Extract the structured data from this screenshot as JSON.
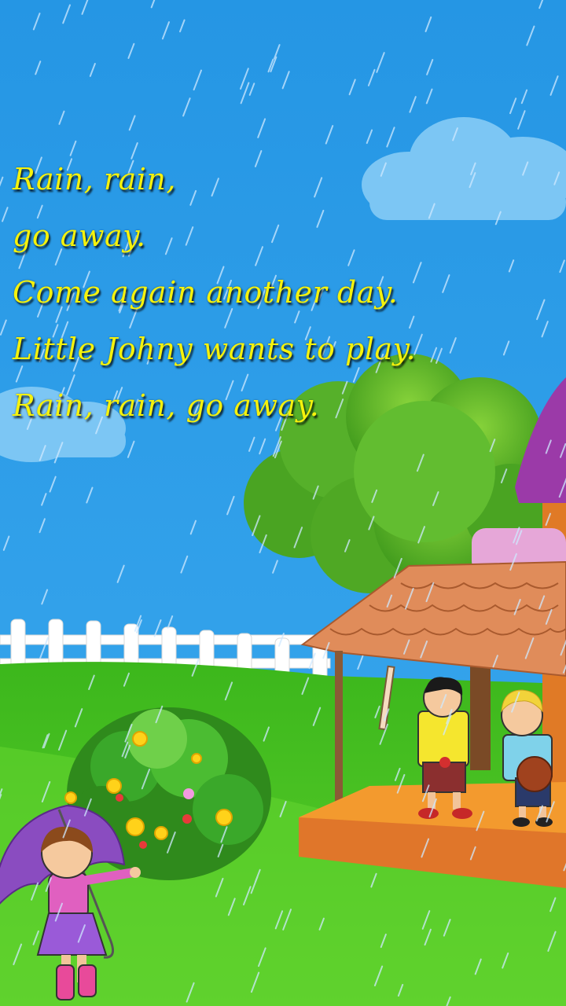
{
  "lyrics": [
    "Rain, rain,",
    "go away.",
    "Come again another day.",
    "Little Johny wants to play.",
    "Rain, rain, go away."
  ],
  "colors": {
    "sky": "#2a9be6",
    "grass": "#47c224",
    "lyric_text": "#f5f20c",
    "roof": "#e08c5a",
    "umbrella": "#8a4cc0"
  },
  "scene_elements": [
    "rain-streaks",
    "clouds",
    "white-picket-fence",
    "tree",
    "house-porch",
    "flower-bush",
    "girl-with-umbrella",
    "boy-with-bat",
    "boy-with-ball"
  ]
}
